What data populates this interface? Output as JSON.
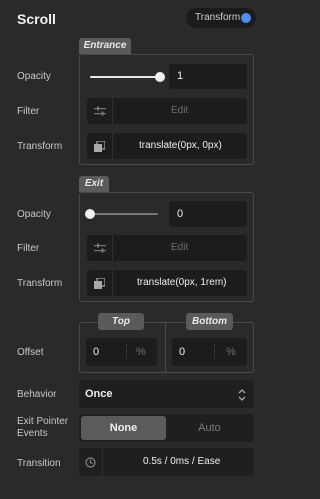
{
  "header": {
    "title": "Scroll",
    "toggle_label": "Transform",
    "toggle_color": "#4d8ef5"
  },
  "entrance": {
    "tab": "Entrance",
    "opacity_label": "Opacity",
    "opacity_value": "1",
    "opacity_level": 1,
    "filter_label": "Filter",
    "filter_button": "Edit",
    "transform_label": "Transform",
    "transform_value": "translate(0px, 0px)"
  },
  "exit": {
    "tab": "Exit",
    "opacity_label": "Opacity",
    "opacity_value": "0",
    "opacity_level": 0,
    "filter_label": "Filter",
    "filter_button": "Edit",
    "transform_label": "Transform",
    "transform_value": "translate(0px, 1rem)"
  },
  "offset": {
    "label": "Offset",
    "top_tab": "Top",
    "top_value": "0",
    "top_unit": "%",
    "bottom_tab": "Bottom",
    "bottom_value": "0",
    "bottom_unit": "%"
  },
  "behavior": {
    "label": "Behavior",
    "value": "Once"
  },
  "pointer_events": {
    "label": "Exit Pointer Events",
    "options": [
      "None",
      "Auto"
    ],
    "selected": "None"
  },
  "transition": {
    "label": "Transition",
    "value": "0.5s / 0ms / Ease"
  },
  "icons": [
    "sliders-icon",
    "transform-icon",
    "chevron-updown-icon",
    "clock-icon"
  ]
}
